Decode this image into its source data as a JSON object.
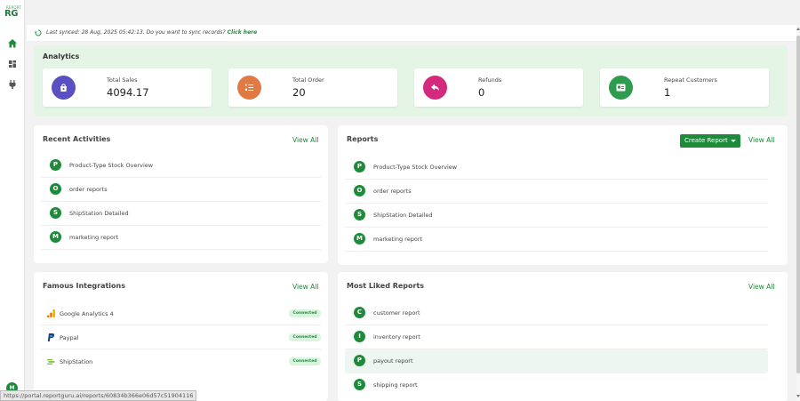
{
  "sidebar": {
    "logo_small": "REPORT",
    "logo_big": "RG",
    "avatar_initial": "M"
  },
  "sync": {
    "text": "Last synced: 28 Aug, 2025 05:42:13. Do you want to sync records?",
    "link": "Click here"
  },
  "analytics": {
    "title": "Analytics",
    "cards": [
      {
        "label": "Total Sales",
        "value": "4094.17",
        "color": "#5b4fc4",
        "icon": "shopping-bag-icon"
      },
      {
        "label": "Total Order",
        "value": "20",
        "color": "#e07a45",
        "icon": "list-numbered-icon"
      },
      {
        "label": "Refunds",
        "value": "0",
        "color": "#d42a7d",
        "icon": "reply-arrow-icon"
      },
      {
        "label": "Repeat Customers",
        "value": "1",
        "color": "#2e9b4e",
        "icon": "id-card-icon"
      }
    ]
  },
  "recent": {
    "title": "Recent Activities",
    "view_all": "View All",
    "items": [
      {
        "letter": "P",
        "label": "Product-Type Stock Overview"
      },
      {
        "letter": "O",
        "label": "order reports"
      },
      {
        "letter": "S",
        "label": "ShipStation Detailed"
      },
      {
        "letter": "M",
        "label": "marketing report"
      }
    ]
  },
  "reports": {
    "title": "Reports",
    "create_label": "Create Report",
    "view_all": "View All",
    "items": [
      {
        "letter": "P",
        "label": "Product-Type Stock Overview"
      },
      {
        "letter": "O",
        "label": "order reports"
      },
      {
        "letter": "S",
        "label": "ShipStation Detailed"
      },
      {
        "letter": "M",
        "label": "marketing report"
      }
    ]
  },
  "integrations": {
    "title": "Famous Integrations",
    "view_all": "View All",
    "items": [
      {
        "label": "Google Analytics 4",
        "status": "Connected",
        "icon": "google-analytics-icon"
      },
      {
        "label": "Paypal",
        "status": "Connected",
        "icon": "paypal-icon"
      },
      {
        "label": "ShipStation",
        "status": "Connected",
        "icon": "shipstation-icon"
      }
    ]
  },
  "liked": {
    "title": "Most Liked Reports",
    "view_all": "View All",
    "items": [
      {
        "letter": "C",
        "label": "customer report"
      },
      {
        "letter": "I",
        "label": "inventory report"
      },
      {
        "letter": "P",
        "label": "payout report"
      },
      {
        "letter": "S",
        "label": "shipping report"
      }
    ]
  },
  "status_url": "https://portal.reportguru.ai/reports/60834b366e06d57c51904116"
}
